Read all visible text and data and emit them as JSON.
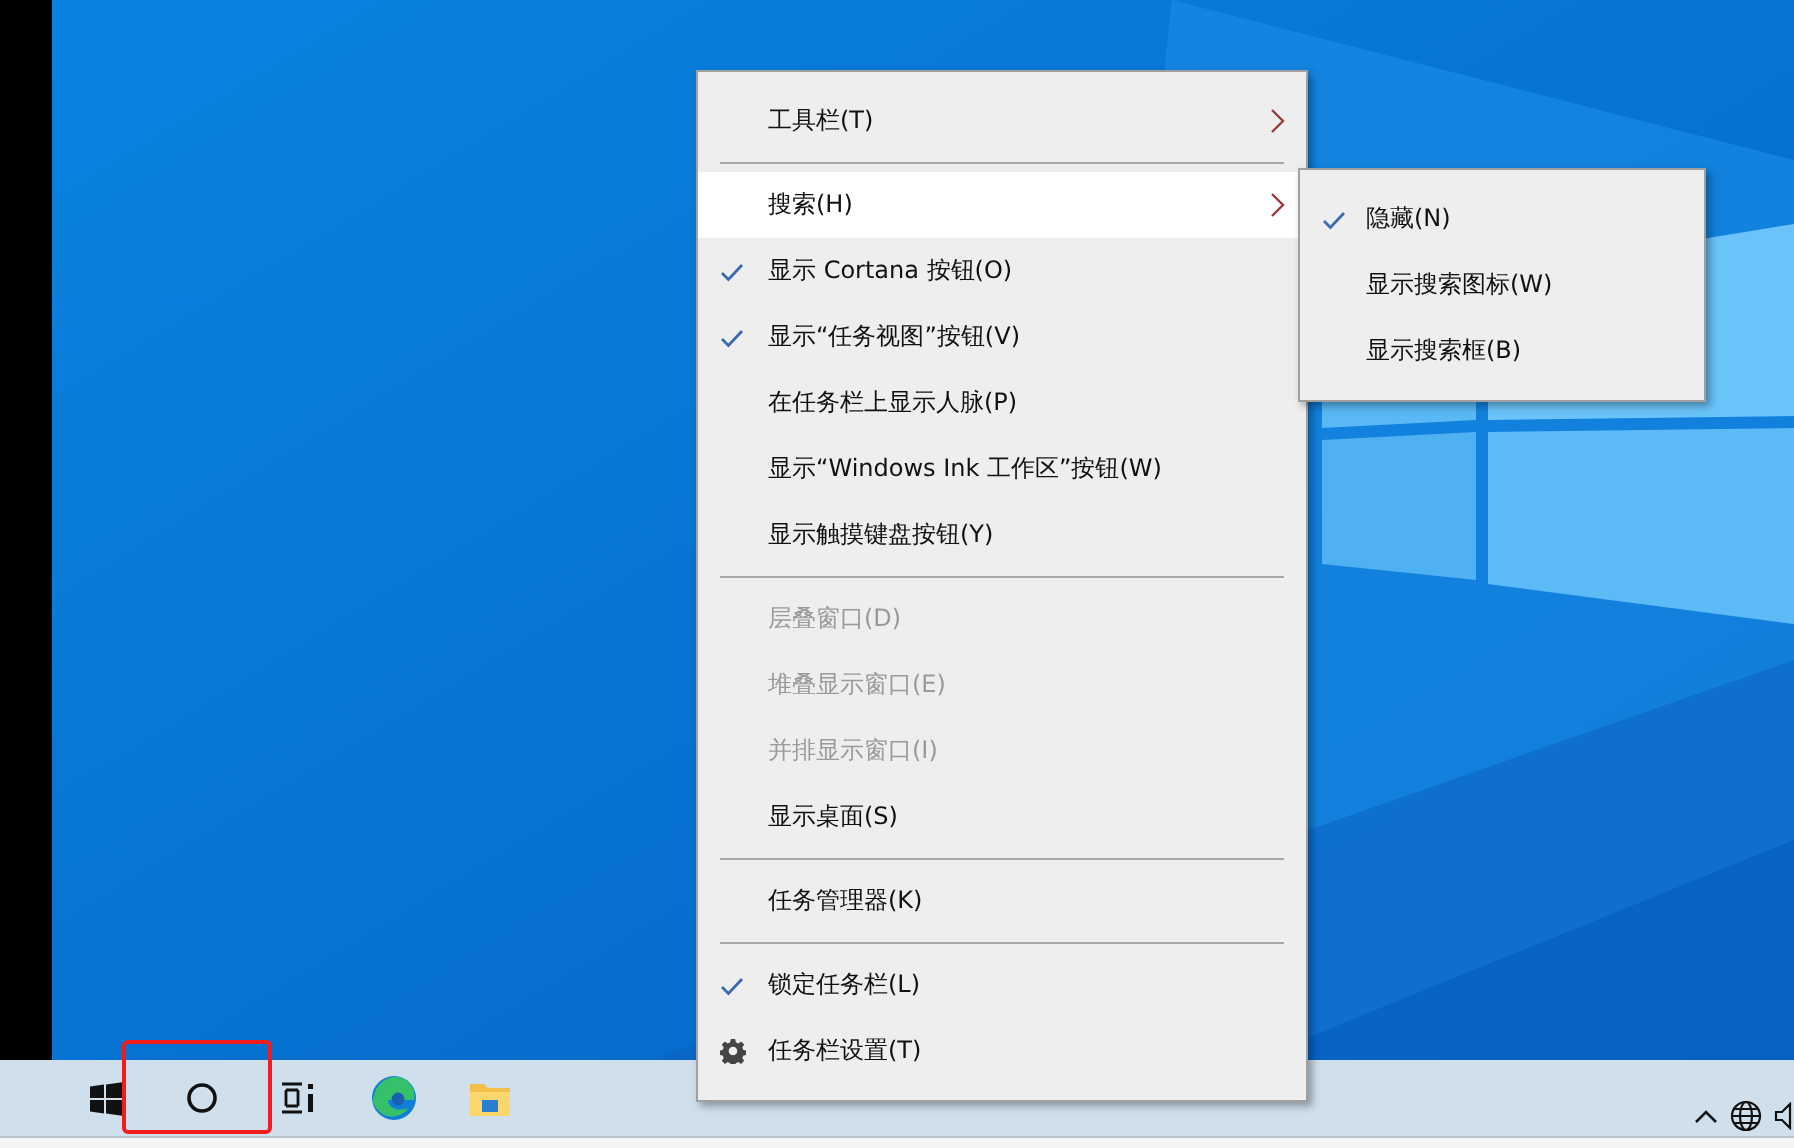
{
  "context_menu": {
    "items": [
      {
        "kind": "item",
        "label": "工具栏(T)",
        "checked": false,
        "disabled": false,
        "submenu": true,
        "selected": false
      },
      {
        "kind": "separator"
      },
      {
        "kind": "item",
        "label": "搜索(H)",
        "checked": false,
        "disabled": false,
        "submenu": true,
        "selected": true
      },
      {
        "kind": "item",
        "label": "显示 Cortana 按钮(O)",
        "checked": true,
        "disabled": false,
        "submenu": false,
        "selected": false
      },
      {
        "kind": "item",
        "label": "显示“任务视图”按钮(V)",
        "checked": true,
        "disabled": false,
        "submenu": false,
        "selected": false
      },
      {
        "kind": "item",
        "label": "在任务栏上显示人脉(P)",
        "checked": false,
        "disabled": false,
        "submenu": false,
        "selected": false
      },
      {
        "kind": "item",
        "label": "显示“Windows Ink 工作区”按钮(W)",
        "checked": false,
        "disabled": false,
        "submenu": false,
        "selected": false
      },
      {
        "kind": "item",
        "label": "显示触摸键盘按钮(Y)",
        "checked": false,
        "disabled": false,
        "submenu": false,
        "selected": false
      },
      {
        "kind": "separator"
      },
      {
        "kind": "item",
        "label": "层叠窗口(D)",
        "checked": false,
        "disabled": true,
        "submenu": false,
        "selected": false
      },
      {
        "kind": "item",
        "label": "堆叠显示窗口(E)",
        "checked": false,
        "disabled": true,
        "submenu": false,
        "selected": false
      },
      {
        "kind": "item",
        "label": "并排显示窗口(I)",
        "checked": false,
        "disabled": true,
        "submenu": false,
        "selected": false
      },
      {
        "kind": "item",
        "label": "显示桌面(S)",
        "checked": false,
        "disabled": false,
        "submenu": false,
        "selected": false
      },
      {
        "kind": "separator"
      },
      {
        "kind": "item",
        "label": "任务管理器(K)",
        "checked": false,
        "disabled": false,
        "submenu": false,
        "selected": false
      },
      {
        "kind": "separator"
      },
      {
        "kind": "item",
        "label": "锁定任务栏(L)",
        "checked": true,
        "disabled": false,
        "submenu": false,
        "selected": false
      },
      {
        "kind": "settings",
        "label": "任务栏设置(T)",
        "checked": false,
        "disabled": false,
        "submenu": false,
        "selected": false
      }
    ]
  },
  "submenu": {
    "items": [
      {
        "label": "隐藏(N)",
        "checked": true
      },
      {
        "label": "显示搜索图标(W)",
        "checked": false
      },
      {
        "label": "显示搜索框(B)",
        "checked": false
      }
    ]
  }
}
